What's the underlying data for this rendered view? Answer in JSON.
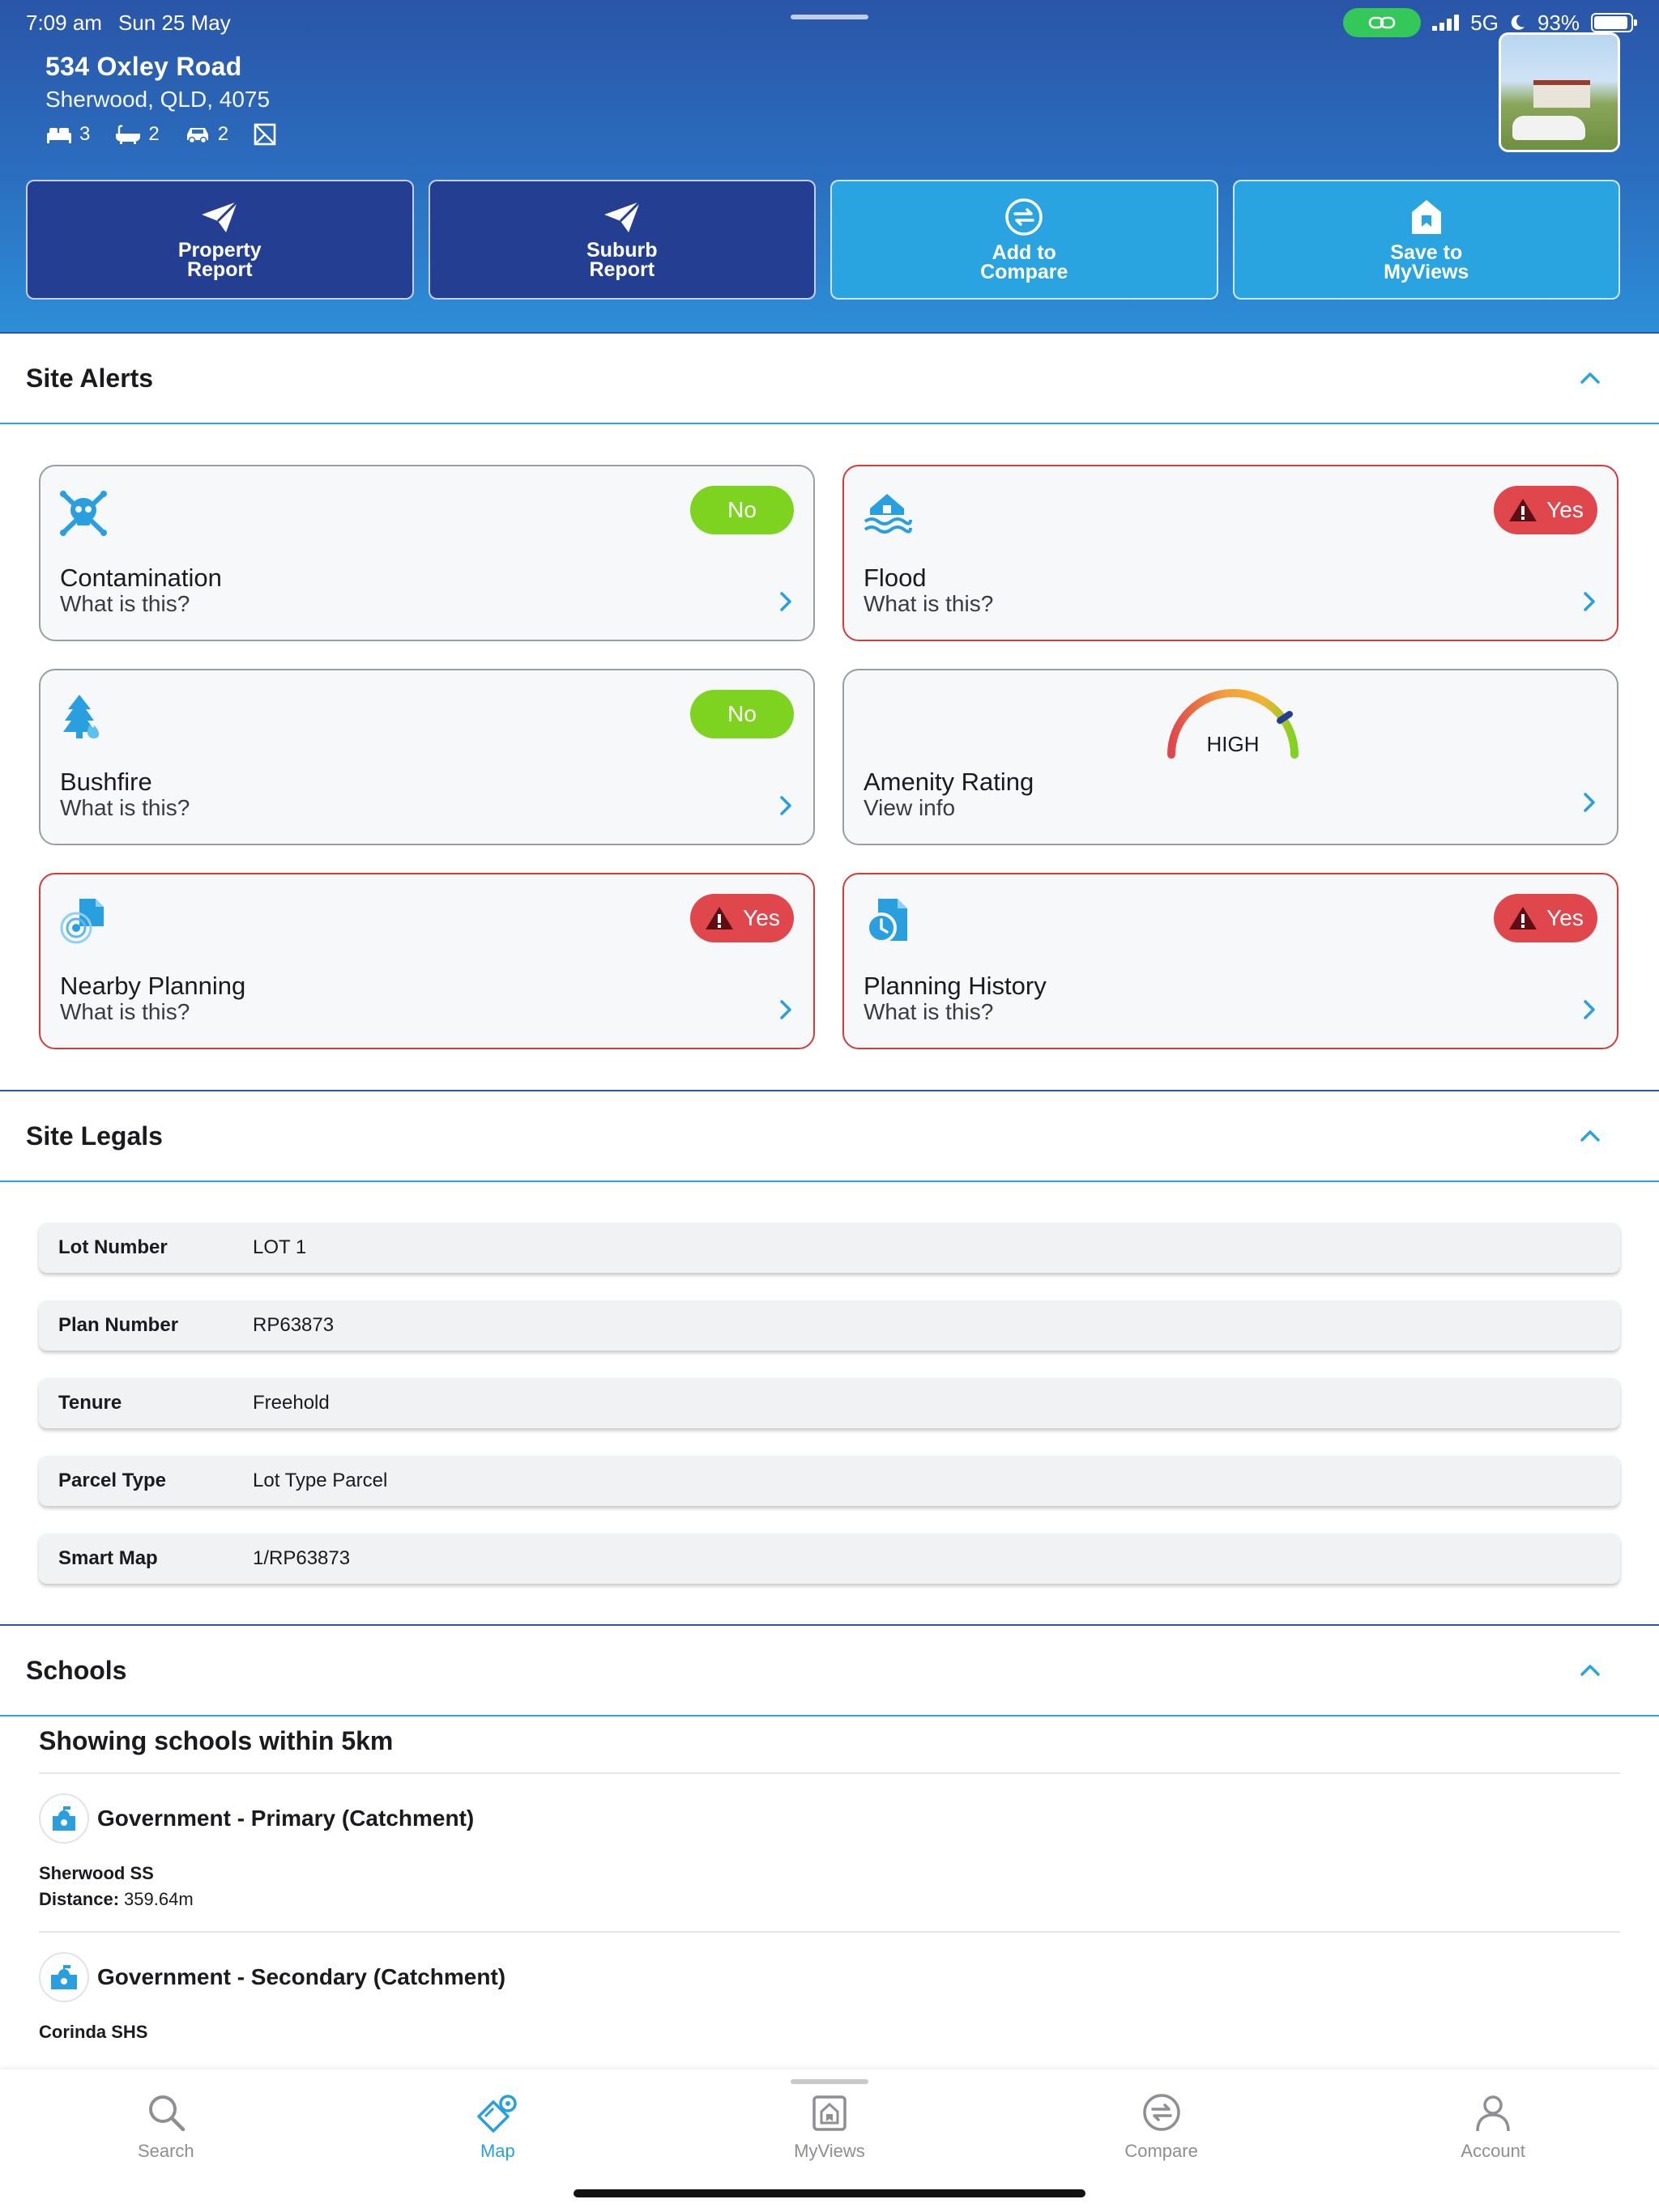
{
  "status": {
    "time": "7:09 am",
    "date": "Sun 25 May",
    "network": "5G",
    "battery": "93%",
    "battery_level": 0.93
  },
  "property": {
    "street": "534 Oxley Road",
    "suburb": "Sherwood, QLD, 4075",
    "beds": "3",
    "baths": "2",
    "cars": "2"
  },
  "actions": [
    {
      "line1": "Property",
      "line2": "Report"
    },
    {
      "line1": "Suburb",
      "line2": "Report"
    },
    {
      "line1": "Add to",
      "line2": "Compare"
    },
    {
      "line1": "Save to",
      "line2": "MyViews"
    }
  ],
  "sections": {
    "alerts": "Site Alerts",
    "legals": "Site Legals",
    "schools": "Schools"
  },
  "alerts": [
    {
      "title": "Contamination",
      "sub": "What is this?",
      "badge": "No"
    },
    {
      "title": "Flood",
      "sub": "What is this?",
      "badge": "Yes"
    },
    {
      "title": "Bushfire",
      "sub": "What is this?",
      "badge": "No"
    },
    {
      "title": "Amenity Rating",
      "sub": "View info",
      "gauge": "HIGH"
    },
    {
      "title": "Nearby Planning",
      "sub": "What is this?",
      "badge": "Yes"
    },
    {
      "title": "Planning History",
      "sub": "What is this?",
      "badge": "Yes"
    }
  ],
  "legals": [
    {
      "k": "Lot Number",
      "v": "LOT 1"
    },
    {
      "k": "Plan Number",
      "v": "RP63873"
    },
    {
      "k": "Tenure",
      "v": "Freehold"
    },
    {
      "k": "Parcel Type",
      "v": "Lot Type Parcel"
    },
    {
      "k": "Smart Map",
      "v": "1/RP63873"
    }
  ],
  "schools": {
    "showing": "Showing schools within 5km",
    "items": [
      {
        "type": "Government - Primary (Catchment)",
        "name": "Sherwood SS",
        "distance_label": "Distance:",
        "distance": "359.64m"
      },
      {
        "type": "Government - Secondary (Catchment)",
        "name": "Corinda SHS"
      }
    ]
  },
  "tabs": [
    "Search",
    "Map",
    "MyViews",
    "Compare",
    "Account"
  ],
  "colors": {
    "dark_action": "#243f92",
    "light_action": "#2aa4e0",
    "yes": "#e0474c",
    "no": "#7ed321",
    "accent": "#2aa4e0"
  }
}
